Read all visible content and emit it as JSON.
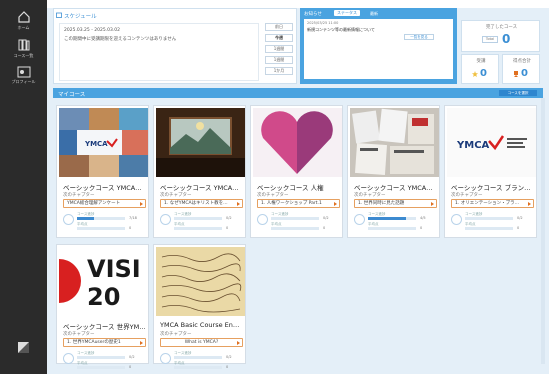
{
  "sidebar": {
    "items": [
      {
        "label": "ホーム",
        "icon": "home-icon"
      },
      {
        "label": "コース一覧",
        "icon": "books-icon"
      },
      {
        "label": "プロフィール",
        "icon": "profile-icon"
      }
    ],
    "bottom_icon": "theme-toggle-icon"
  },
  "schedule": {
    "title": "スケジュール",
    "date_range": "2025.03.25 - 2025.03.02",
    "empty_message": "この期間中に受講期限を迎えるコンテンツはありません",
    "buttons": [
      "前日",
      "今週",
      "1週間",
      "1週間",
      "1か月"
    ]
  },
  "news": {
    "title": "お知らせ",
    "tabs": [
      "全てのお知らせ",
      "ステータス",
      "最新"
    ],
    "item_date": "2025/03/25 11:00",
    "item_text": "新規コンテンツ等の最新情報について",
    "button": "一覧を見る"
  },
  "stats": {
    "completed_label": "完了したコース",
    "completed_value": "0",
    "completed_btn": "Total",
    "in_progress_label": "受講",
    "in_progress_value": "0",
    "points_label": "得点合計",
    "points_value": "0"
  },
  "courses": {
    "title": "マイコース",
    "toggle_btn": "コースを選択",
    "items": [
      {
        "title": "ベーシックコース YMCA…",
        "chapter_label": "次のチャプター",
        "chapter": "YMCA総合理解アンケート",
        "progress_label": "コース進捗",
        "progress": 0.35,
        "progress_text": "7/18",
        "score_label": "平均点",
        "score": "0"
      },
      {
        "title": "ベーシックコース YMCA…",
        "chapter_label": "次のチャプター",
        "chapter": "1. なぜYMCAはキリスト教を…",
        "progress_label": "コース進捗",
        "progress": 0.0,
        "progress_text": "0/2",
        "score_label": "平均点",
        "score": "0"
      },
      {
        "title": "ベーシックコース 人権",
        "chapter_label": "次のチャプター",
        "chapter": "1. 人権ワークショップ Part.1",
        "progress_label": "コース進捗",
        "progress": 0.0,
        "progress_text": "0/2",
        "score_label": "平均点",
        "score": "0"
      },
      {
        "title": "ベーシックコース YMCA…",
        "chapter_label": "次のチャプター",
        "chapter": "1. 世界同時に見た話題",
        "progress_label": "コース進捗",
        "progress": 0.8,
        "progress_text": "4/5",
        "score_label": "平均点",
        "score": "0"
      },
      {
        "title": "ベーシックコース ブラン…",
        "chapter_label": "次のチャプター",
        "chapter": "1. オリエンテーション・ブラ…",
        "progress_label": "コース進捗",
        "progress": 0.0,
        "progress_text": "0/2",
        "score_label": "平均点",
        "score": "0"
      },
      {
        "title": "ベーシックコース 世界YM…",
        "chapter_label": "次のチャプター",
        "chapter": "1. 世界YMCAuserの歴史1",
        "progress_label": "コース進捗",
        "progress": 0.0,
        "progress_text": "0/2",
        "score_label": "平均点",
        "score": "0"
      },
      {
        "title": "YMCA Basic Course En…",
        "chapter_label": "次のチャプター",
        "chapter": "What is YMCA?",
        "progress_label": "コース進捗",
        "progress": 0.0,
        "progress_text": "0/2",
        "score_label": "平均点",
        "score": "0"
      }
    ]
  },
  "colors": {
    "accent": "#4aa3e0",
    "sidebar": "#2b2b2b",
    "bg": "#e4eff8",
    "orange": "#e07020"
  }
}
